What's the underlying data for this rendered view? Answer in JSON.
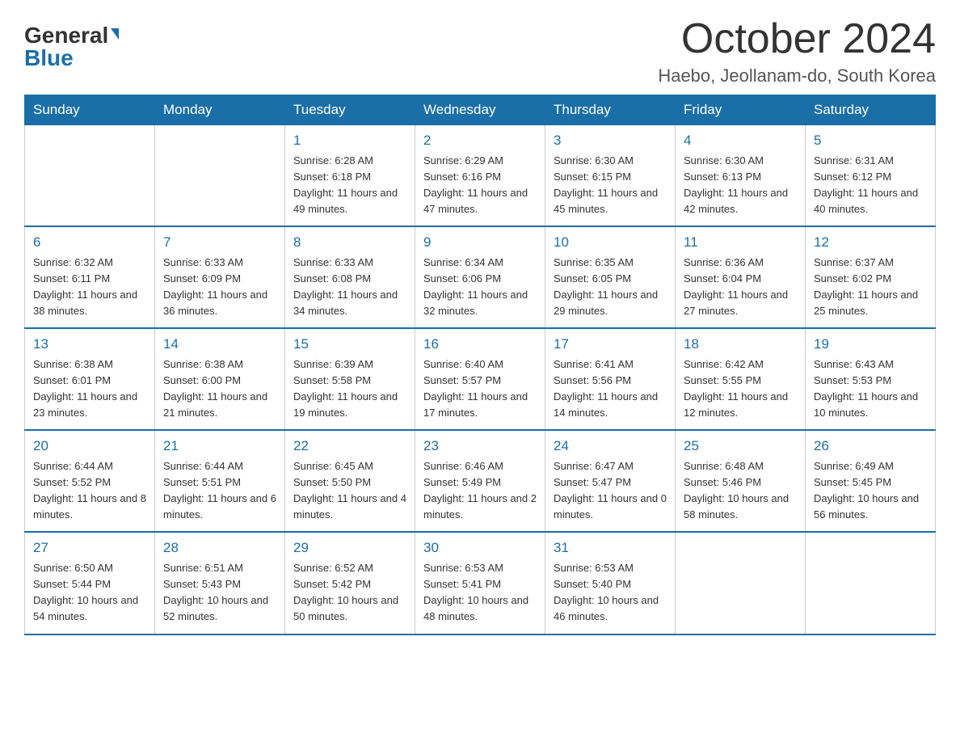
{
  "header": {
    "logo_general": "General",
    "logo_blue": "Blue",
    "month_title": "October 2024",
    "location": "Haebo, Jeollanam-do, South Korea"
  },
  "weekdays": [
    "Sunday",
    "Monday",
    "Tuesday",
    "Wednesday",
    "Thursday",
    "Friday",
    "Saturday"
  ],
  "weeks": [
    [
      {
        "day": "",
        "sunrise": "",
        "sunset": "",
        "daylight": ""
      },
      {
        "day": "",
        "sunrise": "",
        "sunset": "",
        "daylight": ""
      },
      {
        "day": "1",
        "sunrise": "Sunrise: 6:28 AM",
        "sunset": "Sunset: 6:18 PM",
        "daylight": "Daylight: 11 hours and 49 minutes."
      },
      {
        "day": "2",
        "sunrise": "Sunrise: 6:29 AM",
        "sunset": "Sunset: 6:16 PM",
        "daylight": "Daylight: 11 hours and 47 minutes."
      },
      {
        "day": "3",
        "sunrise": "Sunrise: 6:30 AM",
        "sunset": "Sunset: 6:15 PM",
        "daylight": "Daylight: 11 hours and 45 minutes."
      },
      {
        "day": "4",
        "sunrise": "Sunrise: 6:30 AM",
        "sunset": "Sunset: 6:13 PM",
        "daylight": "Daylight: 11 hours and 42 minutes."
      },
      {
        "day": "5",
        "sunrise": "Sunrise: 6:31 AM",
        "sunset": "Sunset: 6:12 PM",
        "daylight": "Daylight: 11 hours and 40 minutes."
      }
    ],
    [
      {
        "day": "6",
        "sunrise": "Sunrise: 6:32 AM",
        "sunset": "Sunset: 6:11 PM",
        "daylight": "Daylight: 11 hours and 38 minutes."
      },
      {
        "day": "7",
        "sunrise": "Sunrise: 6:33 AM",
        "sunset": "Sunset: 6:09 PM",
        "daylight": "Daylight: 11 hours and 36 minutes."
      },
      {
        "day": "8",
        "sunrise": "Sunrise: 6:33 AM",
        "sunset": "Sunset: 6:08 PM",
        "daylight": "Daylight: 11 hours and 34 minutes."
      },
      {
        "day": "9",
        "sunrise": "Sunrise: 6:34 AM",
        "sunset": "Sunset: 6:06 PM",
        "daylight": "Daylight: 11 hours and 32 minutes."
      },
      {
        "day": "10",
        "sunrise": "Sunrise: 6:35 AM",
        "sunset": "Sunset: 6:05 PM",
        "daylight": "Daylight: 11 hours and 29 minutes."
      },
      {
        "day": "11",
        "sunrise": "Sunrise: 6:36 AM",
        "sunset": "Sunset: 6:04 PM",
        "daylight": "Daylight: 11 hours and 27 minutes."
      },
      {
        "day": "12",
        "sunrise": "Sunrise: 6:37 AM",
        "sunset": "Sunset: 6:02 PM",
        "daylight": "Daylight: 11 hours and 25 minutes."
      }
    ],
    [
      {
        "day": "13",
        "sunrise": "Sunrise: 6:38 AM",
        "sunset": "Sunset: 6:01 PM",
        "daylight": "Daylight: 11 hours and 23 minutes."
      },
      {
        "day": "14",
        "sunrise": "Sunrise: 6:38 AM",
        "sunset": "Sunset: 6:00 PM",
        "daylight": "Daylight: 11 hours and 21 minutes."
      },
      {
        "day": "15",
        "sunrise": "Sunrise: 6:39 AM",
        "sunset": "Sunset: 5:58 PM",
        "daylight": "Daylight: 11 hours and 19 minutes."
      },
      {
        "day": "16",
        "sunrise": "Sunrise: 6:40 AM",
        "sunset": "Sunset: 5:57 PM",
        "daylight": "Daylight: 11 hours and 17 minutes."
      },
      {
        "day": "17",
        "sunrise": "Sunrise: 6:41 AM",
        "sunset": "Sunset: 5:56 PM",
        "daylight": "Daylight: 11 hours and 14 minutes."
      },
      {
        "day": "18",
        "sunrise": "Sunrise: 6:42 AM",
        "sunset": "Sunset: 5:55 PM",
        "daylight": "Daylight: 11 hours and 12 minutes."
      },
      {
        "day": "19",
        "sunrise": "Sunrise: 6:43 AM",
        "sunset": "Sunset: 5:53 PM",
        "daylight": "Daylight: 11 hours and 10 minutes."
      }
    ],
    [
      {
        "day": "20",
        "sunrise": "Sunrise: 6:44 AM",
        "sunset": "Sunset: 5:52 PM",
        "daylight": "Daylight: 11 hours and 8 minutes."
      },
      {
        "day": "21",
        "sunrise": "Sunrise: 6:44 AM",
        "sunset": "Sunset: 5:51 PM",
        "daylight": "Daylight: 11 hours and 6 minutes."
      },
      {
        "day": "22",
        "sunrise": "Sunrise: 6:45 AM",
        "sunset": "Sunset: 5:50 PM",
        "daylight": "Daylight: 11 hours and 4 minutes."
      },
      {
        "day": "23",
        "sunrise": "Sunrise: 6:46 AM",
        "sunset": "Sunset: 5:49 PM",
        "daylight": "Daylight: 11 hours and 2 minutes."
      },
      {
        "day": "24",
        "sunrise": "Sunrise: 6:47 AM",
        "sunset": "Sunset: 5:47 PM",
        "daylight": "Daylight: 11 hours and 0 minutes."
      },
      {
        "day": "25",
        "sunrise": "Sunrise: 6:48 AM",
        "sunset": "Sunset: 5:46 PM",
        "daylight": "Daylight: 10 hours and 58 minutes."
      },
      {
        "day": "26",
        "sunrise": "Sunrise: 6:49 AM",
        "sunset": "Sunset: 5:45 PM",
        "daylight": "Daylight: 10 hours and 56 minutes."
      }
    ],
    [
      {
        "day": "27",
        "sunrise": "Sunrise: 6:50 AM",
        "sunset": "Sunset: 5:44 PM",
        "daylight": "Daylight: 10 hours and 54 minutes."
      },
      {
        "day": "28",
        "sunrise": "Sunrise: 6:51 AM",
        "sunset": "Sunset: 5:43 PM",
        "daylight": "Daylight: 10 hours and 52 minutes."
      },
      {
        "day": "29",
        "sunrise": "Sunrise: 6:52 AM",
        "sunset": "Sunset: 5:42 PM",
        "daylight": "Daylight: 10 hours and 50 minutes."
      },
      {
        "day": "30",
        "sunrise": "Sunrise: 6:53 AM",
        "sunset": "Sunset: 5:41 PM",
        "daylight": "Daylight: 10 hours and 48 minutes."
      },
      {
        "day": "31",
        "sunrise": "Sunrise: 6:53 AM",
        "sunset": "Sunset: 5:40 PM",
        "daylight": "Daylight: 10 hours and 46 minutes."
      },
      {
        "day": "",
        "sunrise": "",
        "sunset": "",
        "daylight": ""
      },
      {
        "day": "",
        "sunrise": "",
        "sunset": "",
        "daylight": ""
      }
    ]
  ]
}
